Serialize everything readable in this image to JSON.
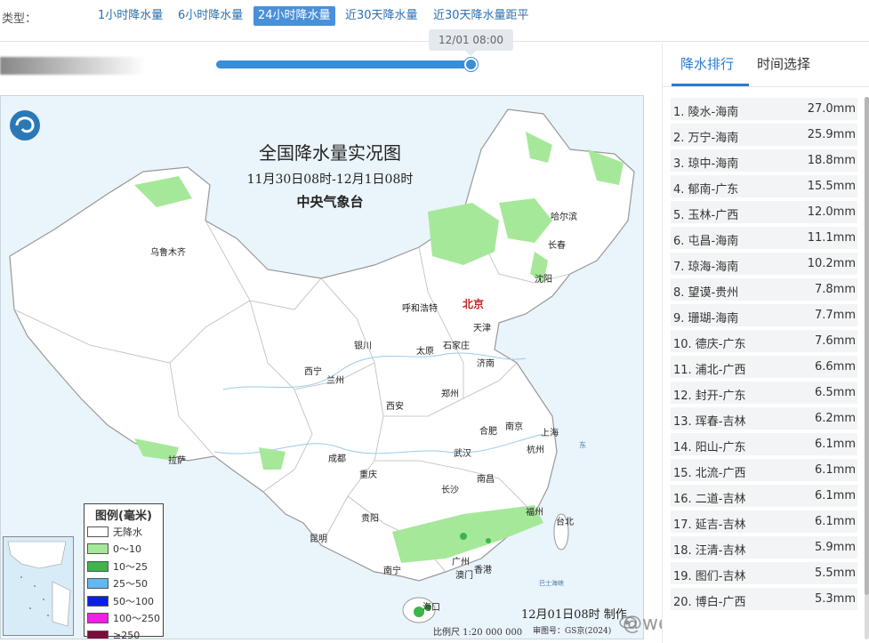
{
  "type_bar": {
    "label": "类型：",
    "tabs": [
      {
        "label": "1小时降水量",
        "active": false
      },
      {
        "label": "6小时降水量",
        "active": false
      },
      {
        "label": "24小时降水量",
        "active": true
      },
      {
        "label": "近30天降水量",
        "active": false
      },
      {
        "label": "近30天降水量距平",
        "active": false
      }
    ]
  },
  "timeline": {
    "current_time": "12/01 08:00",
    "progress": 1.0
  },
  "map": {
    "title": "全国降水量实况图",
    "subtitle": "11月30日08时-12月1日08时",
    "issuer": "中央气象台",
    "cities": [
      {
        "name": "北京",
        "capital": true
      },
      {
        "name": "哈尔滨"
      },
      {
        "name": "长春"
      },
      {
        "name": "沈阳"
      },
      {
        "name": "乌鲁木齐"
      },
      {
        "name": "呼和浩特"
      },
      {
        "name": "天津"
      },
      {
        "name": "石家庄"
      },
      {
        "name": "太原"
      },
      {
        "name": "银川"
      },
      {
        "name": "济南"
      },
      {
        "name": "西宁"
      },
      {
        "name": "兰州"
      },
      {
        "name": "郑州"
      },
      {
        "name": "西安"
      },
      {
        "name": "合肥"
      },
      {
        "name": "南京"
      },
      {
        "name": "上海"
      },
      {
        "name": "武汉"
      },
      {
        "name": "杭州"
      },
      {
        "name": "拉萨"
      },
      {
        "name": "成都"
      },
      {
        "name": "重庆"
      },
      {
        "name": "南昌"
      },
      {
        "name": "长沙"
      },
      {
        "name": "福州"
      },
      {
        "name": "台北"
      },
      {
        "name": "贵阳"
      },
      {
        "name": "昆明"
      },
      {
        "name": "广州"
      },
      {
        "name": "香港"
      },
      {
        "name": "澳门"
      },
      {
        "name": "南宁"
      },
      {
        "name": "海口"
      }
    ],
    "legend": {
      "title": "图例(毫米)",
      "items": [
        {
          "label": "无降水",
          "color": "#ffffff"
        },
        {
          "label": "0～10",
          "color": "#a6e89a"
        },
        {
          "label": "10～25",
          "color": "#3cb54a"
        },
        {
          "label": "25～50",
          "color": "#62b8f0"
        },
        {
          "label": "50～100",
          "color": "#0a1fe6"
        },
        {
          "label": "100～250",
          "color": "#f01ee6"
        },
        {
          "label": "≥250",
          "color": "#7a0f3c"
        }
      ]
    },
    "inset_label": "",
    "made_date": "12月01日08时 制作",
    "scale": "比例尺 1:20 000 000",
    "review_no": "审图号：GS京(2024)",
    "watermark": "@weatherman_信欣"
  },
  "sidebar": {
    "tabs": [
      {
        "label": "降水排行",
        "active": true
      },
      {
        "label": "时间选择",
        "active": false
      }
    ],
    "ranking": [
      {
        "name": "1. 陵水-海南",
        "value": "27.0mm"
      },
      {
        "name": "2. 万宁-海南",
        "value": "25.9mm"
      },
      {
        "name": "3. 琼中-海南",
        "value": "18.8mm"
      },
      {
        "name": "4. 郁南-广东",
        "value": "15.5mm"
      },
      {
        "name": "5. 玉林-广西",
        "value": "12.0mm"
      },
      {
        "name": "6. 屯昌-海南",
        "value": "11.1mm"
      },
      {
        "name": "7. 琼海-海南",
        "value": "10.2mm"
      },
      {
        "name": "8. 望谟-贵州",
        "value": "7.8mm"
      },
      {
        "name": "9. 珊瑚-海南",
        "value": "7.7mm"
      },
      {
        "name": "10. 德庆-广东",
        "value": "7.6mm"
      },
      {
        "name": "11. 浦北-广西",
        "value": "6.6mm"
      },
      {
        "name": "12. 封开-广东",
        "value": "6.5mm"
      },
      {
        "name": "13. 珲春-吉林",
        "value": "6.2mm"
      },
      {
        "name": "14. 阳山-广东",
        "value": "6.1mm"
      },
      {
        "name": "15. 北流-广西",
        "value": "6.1mm"
      },
      {
        "name": "16. 二道-吉林",
        "value": "6.1mm"
      },
      {
        "name": "17. 延吉-吉林",
        "value": "6.1mm"
      },
      {
        "name": "18. 汪清-吉林",
        "value": "5.9mm"
      },
      {
        "name": "19. 图们-吉林",
        "value": "5.5mm"
      },
      {
        "name": "20. 博白-广西",
        "value": "5.3mm"
      }
    ]
  }
}
